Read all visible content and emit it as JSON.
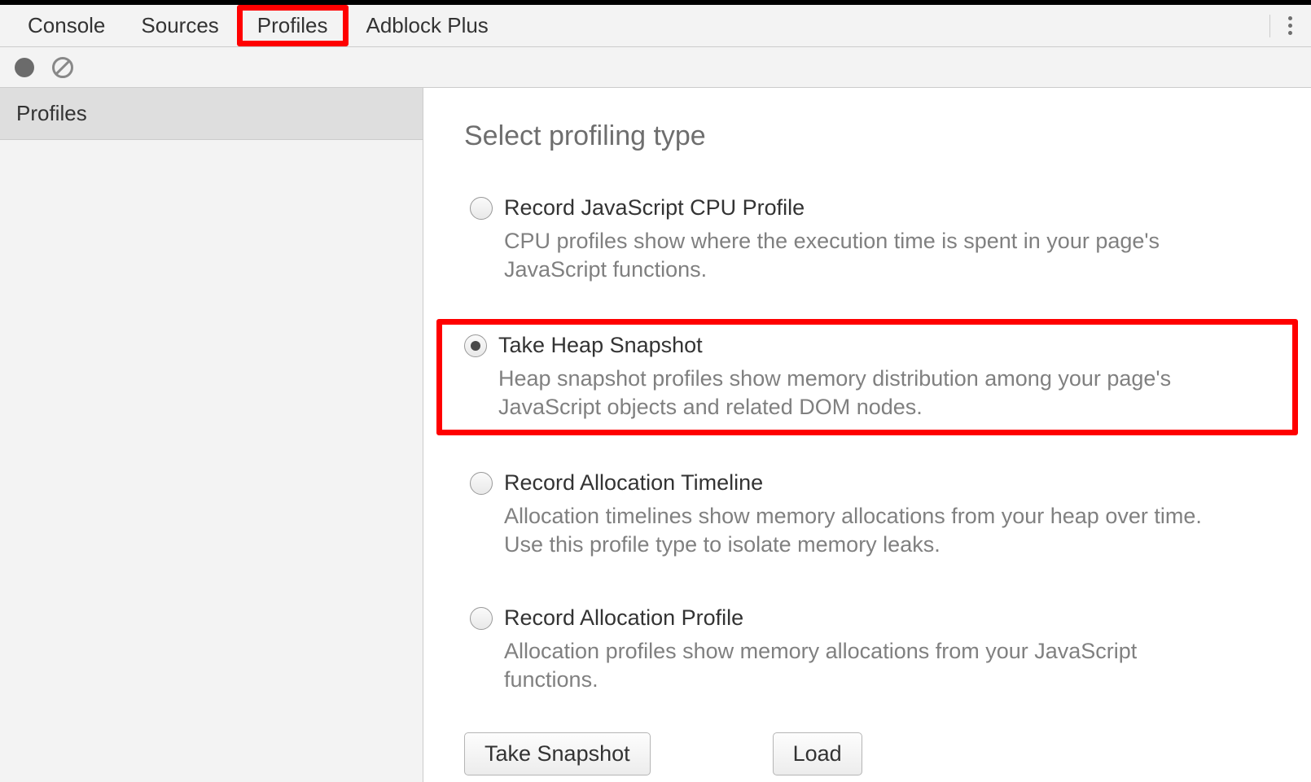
{
  "tabs": {
    "console": "Console",
    "sources": "Sources",
    "profiles": "Profiles",
    "adblock": "Adblock Plus"
  },
  "sidebar": {
    "profiles_label": "Profiles"
  },
  "content": {
    "heading": "Select profiling type",
    "options": [
      {
        "title": "Record JavaScript CPU Profile",
        "desc": "CPU profiles show where the execution time is spent in your page's JavaScript functions."
      },
      {
        "title": "Take Heap Snapshot",
        "desc": "Heap snapshot profiles show memory distribution among your page's JavaScript objects and related DOM nodes."
      },
      {
        "title": "Record Allocation Timeline",
        "desc": "Allocation timelines show memory allocations from your heap over time. Use this profile type to isolate memory leaks."
      },
      {
        "title": "Record Allocation Profile",
        "desc": "Allocation profiles show memory allocations from your JavaScript functions."
      }
    ],
    "buttons": {
      "primary": "Take Snapshot",
      "load": "Load"
    }
  }
}
